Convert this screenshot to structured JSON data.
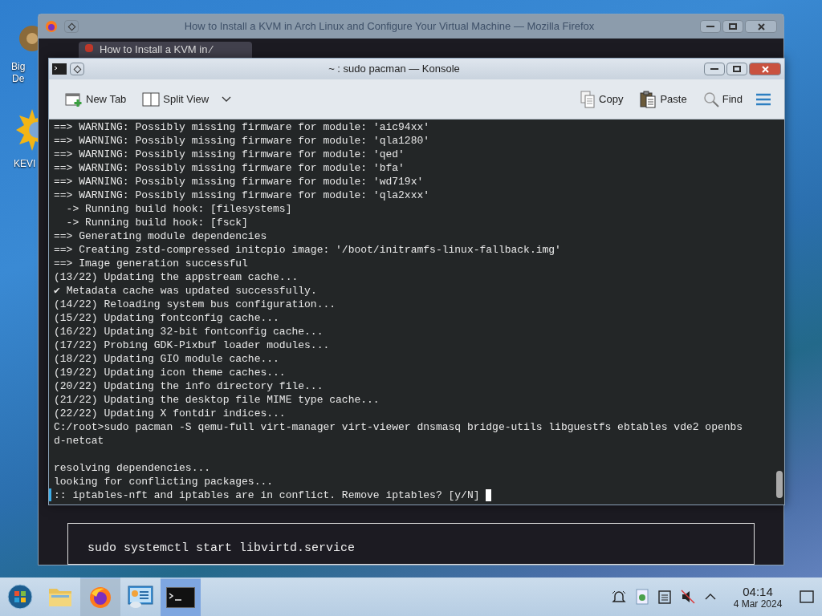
{
  "desktop_icons": [
    {
      "lines": [
        "Big",
        "De"
      ]
    },
    {
      "lines": [
        "KEVI"
      ]
    }
  ],
  "browser_window": {
    "title": "How to Install a KVM in Arch Linux and Configure Your Virtual Machine — Mozilla Firefox",
    "tab": "How to Install a KVM in ⁄",
    "code": "sudo systemctl start libvirtd.service"
  },
  "konsole": {
    "title": "~ : sudo pacman — Konsole",
    "toolbar_left": [
      {
        "kind": "new-tab",
        "label": "New Tab"
      },
      {
        "kind": "split",
        "label": "Split View"
      }
    ],
    "toolbar_right": [
      {
        "kind": "copy",
        "label": "Copy"
      },
      {
        "kind": "paste",
        "label": "Paste"
      },
      {
        "kind": "find",
        "label": "Find"
      }
    ],
    "lines": [
      "==> WARNING: Possibly missing firmware for module: 'aic94xx'",
      "==> WARNING: Possibly missing firmware for module: 'qla1280'",
      "==> WARNING: Possibly missing firmware for module: 'qed'",
      "==> WARNING: Possibly missing firmware for module: 'bfa'",
      "==> WARNING: Possibly missing firmware for module: 'wd719x'",
      "==> WARNING: Possibly missing firmware for module: 'qla2xxx'",
      "  -> Running build hook: [filesystems]",
      "  -> Running build hook: [fsck]",
      "==> Generating module dependencies",
      "==> Creating zstd-compressed initcpio image: '/boot/initramfs-linux-fallback.img'",
      "==> Image generation successful",
      "(13/22) Updating the appstream cache...",
      "✔ Metadata cache was updated successfully.",
      "(14/22) Reloading system bus configuration...",
      "(15/22) Updating fontconfig cache...",
      "(16/22) Updating 32-bit fontconfig cache...",
      "(17/22) Probing GDK-Pixbuf loader modules...",
      "(18/22) Updating GIO module cache...",
      "(19/22) Updating icon theme caches...",
      "(20/22) Updating the info directory file...",
      "(21/22) Updating the desktop file MIME type cache...",
      "(22/22) Updating X fontdir indices...",
      "C:/root>sudo pacman -S qemu-full virt-manager virt-viewer dnsmasq bridge-utils libguestfs ebtables vde2 openbs",
      "d-netcat"
    ],
    "lines_after_blank": [
      "resolving dependencies...",
      "looking for conflicting packages...",
      ":: iptables-nft and iptables are in conflict. Remove iptables? [y/N] "
    ]
  },
  "taskbar": {
    "tasks": [
      {
        "kind": "start",
        "running": false,
        "selected": false
      },
      {
        "kind": "files",
        "running": false,
        "selected": false
      },
      {
        "kind": "firefox",
        "running": true,
        "selected": false
      },
      {
        "kind": "settings",
        "running": false,
        "selected": false
      },
      {
        "kind": "terminal",
        "running": true,
        "selected": true
      }
    ],
    "time": "04:14",
    "date": "4 Mar 2024"
  }
}
